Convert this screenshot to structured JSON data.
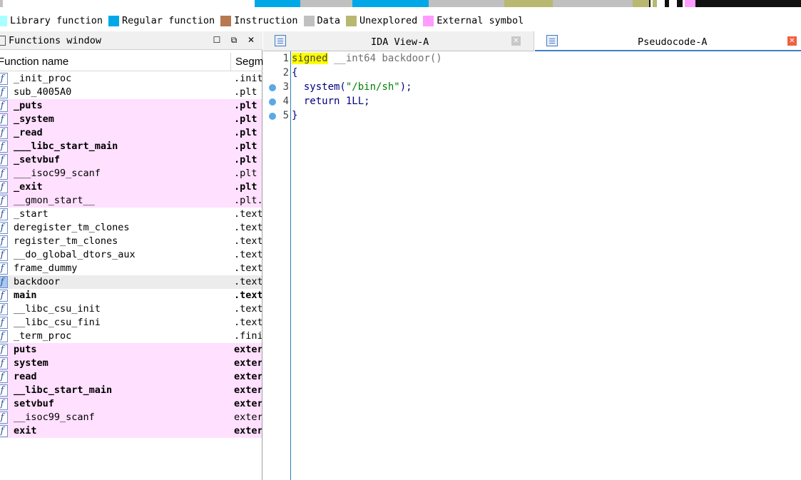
{
  "navband": {
    "segments": [
      {
        "color": "#c0c0c0",
        "start": 0.0,
        "end": 0.004
      },
      {
        "color": "#00a8e8",
        "start": 0.318,
        "end": 0.375
      },
      {
        "color": "#c0c0c0",
        "start": 0.375,
        "end": 0.44
      },
      {
        "color": "#00a8e8",
        "start": 0.44,
        "end": 0.535
      },
      {
        "color": "#c0c0c0",
        "start": 0.535,
        "end": 0.63
      },
      {
        "color": "#b8b870",
        "start": 0.63,
        "end": 0.69
      },
      {
        "color": "#c0c0c0",
        "start": 0.69,
        "end": 0.79
      },
      {
        "color": "#b8b870",
        "start": 0.79,
        "end": 0.81
      },
      {
        "color": "#111111",
        "start": 0.81,
        "end": 0.812
      },
      {
        "color": "#b8b870",
        "start": 0.815,
        "end": 0.82
      },
      {
        "color": "#111111",
        "start": 0.83,
        "end": 0.835
      },
      {
        "color": "#111111",
        "start": 0.845,
        "end": 0.852
      },
      {
        "color": "#ff9cff",
        "start": 0.855,
        "end": 0.868
      },
      {
        "color": "#111111",
        "start": 0.868,
        "end": 1.0
      }
    ]
  },
  "legend": [
    {
      "label": "Library function",
      "color": "#a8ffff"
    },
    {
      "label": "Regular function",
      "color": "#00a8e8"
    },
    {
      "label": "Instruction",
      "color": "#b87850"
    },
    {
      "label": "Data",
      "color": "#c0c0c0"
    },
    {
      "label": "Unexplored",
      "color": "#b8b870"
    },
    {
      "label": "External symbol",
      "color": "#ff9cff"
    }
  ],
  "functions_window": {
    "title": "Functions window",
    "col_name": "Function name",
    "col_segment": "Segm",
    "icon_glyph": "f",
    "rows": [
      {
        "name": "_init_proc",
        "segment": ".init",
        "bold": false,
        "ext": false
      },
      {
        "name": "sub_4005A0",
        "segment": ".plt",
        "bold": false,
        "ext": false
      },
      {
        "name": "_puts",
        "segment": ".plt",
        "bold": true,
        "ext": true
      },
      {
        "name": "_system",
        "segment": ".plt",
        "bold": true,
        "ext": true
      },
      {
        "name": "_read",
        "segment": ".plt",
        "bold": true,
        "ext": true
      },
      {
        "name": "___libc_start_main",
        "segment": ".plt",
        "bold": true,
        "ext": true
      },
      {
        "name": "_setvbuf",
        "segment": ".plt",
        "bold": true,
        "ext": true
      },
      {
        "name": "___isoc99_scanf",
        "segment": ".plt",
        "bold": false,
        "ext": true
      },
      {
        "name": "_exit",
        "segment": ".plt",
        "bold": true,
        "ext": true
      },
      {
        "name": "__gmon_start__",
        "segment": ".plt.",
        "bold": false,
        "ext": true
      },
      {
        "name": "_start",
        "segment": ".text",
        "bold": false,
        "ext": false
      },
      {
        "name": "deregister_tm_clones",
        "segment": ".text",
        "bold": false,
        "ext": false
      },
      {
        "name": "register_tm_clones",
        "segment": ".text",
        "bold": false,
        "ext": false
      },
      {
        "name": "__do_global_dtors_aux",
        "segment": ".text",
        "bold": false,
        "ext": false
      },
      {
        "name": "frame_dummy",
        "segment": ".text",
        "bold": false,
        "ext": false
      },
      {
        "name": "backdoor",
        "segment": ".text",
        "bold": false,
        "ext": false,
        "selected": true
      },
      {
        "name": "main",
        "segment": ".text",
        "bold": true,
        "ext": false
      },
      {
        "name": "__libc_csu_init",
        "segment": ".text",
        "bold": false,
        "ext": false
      },
      {
        "name": "__libc_csu_fini",
        "segment": ".text",
        "bold": false,
        "ext": false
      },
      {
        "name": "_term_proc",
        "segment": ".fini",
        "bold": false,
        "ext": false
      },
      {
        "name": "puts",
        "segment": "exter",
        "bold": true,
        "ext": true
      },
      {
        "name": "system",
        "segment": "exter",
        "bold": true,
        "ext": true
      },
      {
        "name": "read",
        "segment": "exter",
        "bold": true,
        "ext": true
      },
      {
        "name": "__libc_start_main",
        "segment": "exter",
        "bold": true,
        "ext": true
      },
      {
        "name": "setvbuf",
        "segment": "exter",
        "bold": true,
        "ext": true
      },
      {
        "name": "__isoc99_scanf",
        "segment": "exter",
        "bold": false,
        "ext": true
      },
      {
        "name": "exit",
        "segment": "exter",
        "bold": true,
        "ext": true
      }
    ]
  },
  "tabs": {
    "ida_view": "IDA View-A",
    "pseudocode": "Pseudocode-A"
  },
  "code": {
    "lines": [
      {
        "num": "1",
        "breakpoint": false,
        "parts": [
          {
            "t": "signed",
            "c": "kw-hl"
          },
          {
            "t": " __int64 backdoor()",
            "c": "gray"
          }
        ]
      },
      {
        "num": "2",
        "breakpoint": false,
        "parts": [
          {
            "t": "{",
            "c": "navy"
          }
        ]
      },
      {
        "num": "3",
        "breakpoint": true,
        "parts": [
          {
            "t": "  system(",
            "c": "navy"
          },
          {
            "t": "\"/bin/sh\"",
            "c": "green"
          },
          {
            "t": ");",
            "c": "navy"
          }
        ]
      },
      {
        "num": "4",
        "breakpoint": true,
        "parts": [
          {
            "t": "  return 1LL;",
            "c": "navy"
          }
        ]
      },
      {
        "num": "5",
        "breakpoint": true,
        "parts": [
          {
            "t": "}",
            "c": "navy"
          }
        ]
      }
    ]
  }
}
